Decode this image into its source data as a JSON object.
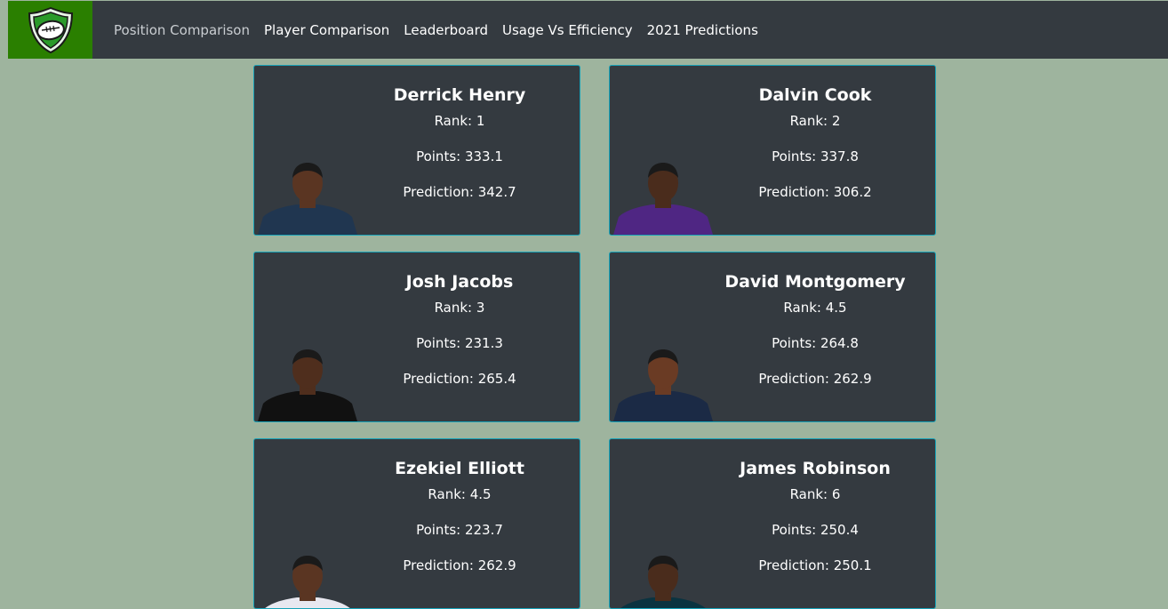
{
  "nav": {
    "items": [
      {
        "label": "Position Comparison",
        "active": true
      },
      {
        "label": "Player Comparison",
        "active": false
      },
      {
        "label": "Leaderboard",
        "active": false
      },
      {
        "label": "Usage Vs Efficiency",
        "active": false
      },
      {
        "label": "2021 Predictions",
        "active": false
      }
    ]
  },
  "colors": {
    "page_bg": "#9eb49e",
    "navbar_bg": "#343a40",
    "brand_bg": "#2a7f00",
    "card_bg": "#343a40",
    "card_border": "#17a2b8"
  },
  "players": [
    {
      "name": "Derrick Henry",
      "rank": "Rank: 1",
      "points": "Points: 333.1",
      "prediction": "Prediction: 342.7",
      "jersey": "#203650",
      "skin": "#5a3522"
    },
    {
      "name": "Dalvin Cook",
      "rank": "Rank: 2",
      "points": "Points: 337.8",
      "prediction": "Prediction: 306.2",
      "jersey": "#4f2683",
      "skin": "#4a2c1c"
    },
    {
      "name": "Josh Jacobs",
      "rank": "Rank: 3",
      "points": "Points: 231.3",
      "prediction": "Prediction: 265.4",
      "jersey": "#111111",
      "skin": "#4f2e1d"
    },
    {
      "name": "David Montgomery",
      "rank": "Rank: 4.5",
      "points": "Points: 264.8",
      "prediction": "Prediction: 262.9",
      "jersey": "#1b2a45",
      "skin": "#6a3b24"
    },
    {
      "name": "Ezekiel Elliott",
      "rank": "Rank: 4.5",
      "points": "Points: 223.7",
      "prediction": "Prediction: 262.9",
      "jersey": "#e8e8f0",
      "skin": "#5a3522"
    },
    {
      "name": "James Robinson",
      "rank": "Rank: 6",
      "points": "Points: 250.4",
      "prediction": "Prediction: 250.1",
      "jersey": "#0a3340",
      "skin": "#4a2c1c"
    }
  ]
}
